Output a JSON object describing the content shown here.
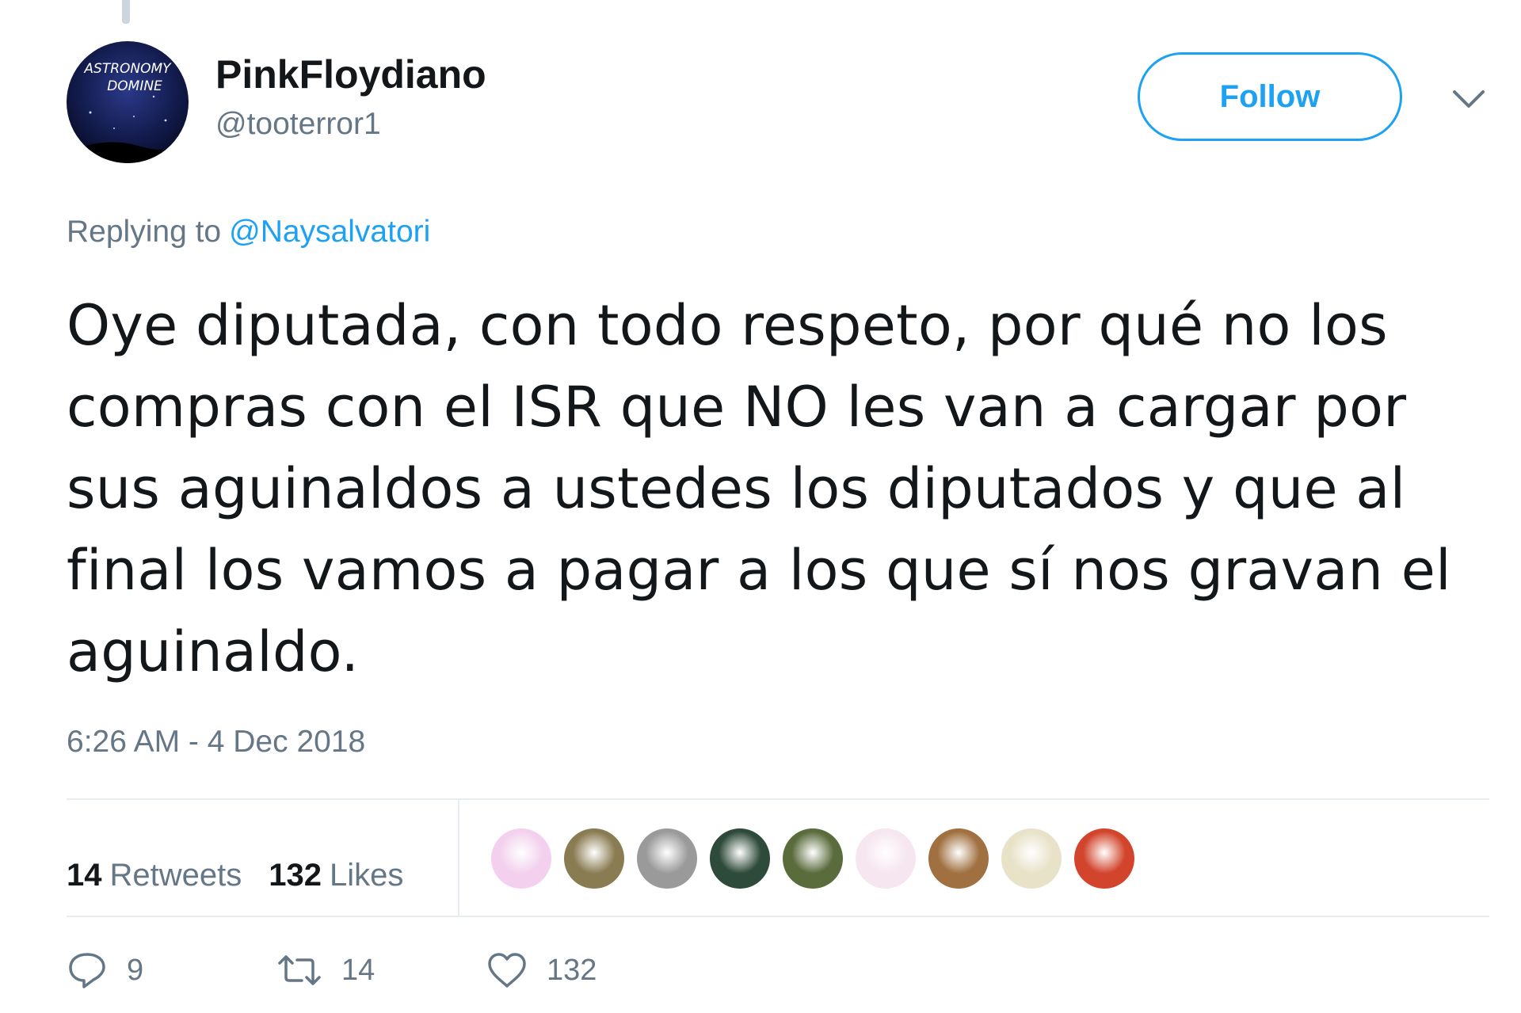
{
  "colors": {
    "accent": "#1da1f2",
    "text": "#14171a",
    "secondary": "#657786",
    "divider": "#e6ecf0"
  },
  "author": {
    "avatar_text_line1": "ASTRONOMY",
    "avatar_text_line2": "DOMINE",
    "display_name": "PinkFloydiano",
    "handle": "@tooterror1"
  },
  "header": {
    "follow_label": "Follow",
    "menu_icon": "chevron-down-icon"
  },
  "reply_context": {
    "prefix": "Replying to",
    "mention": "@Naysalvatori"
  },
  "tweet": {
    "text": "Oye diputada, con todo respeto, por qué no los compras con el ISR que NO les van a cargar por sus aguinaldos a ustedes los diputados y que al final los vamos a pagar a los que sí nos gravan el aguinaldo.",
    "timestamp": "6:26 AM - 4 Dec 2018"
  },
  "stats": {
    "retweets_count": "14",
    "retweets_label": "Retweets",
    "likes_count": "132",
    "likes_label": "Likes"
  },
  "likers": [
    {
      "name": "liker-avatar-1",
      "color": "#f3d1ee"
    },
    {
      "name": "liker-avatar-2",
      "color": "#8a7c52"
    },
    {
      "name": "liker-avatar-3",
      "color": "#9a9a9a"
    },
    {
      "name": "liker-avatar-4",
      "color": "#2e4a3a"
    },
    {
      "name": "liker-avatar-5",
      "color": "#5a6b3c"
    },
    {
      "name": "liker-avatar-6",
      "color": "#f6e6ef"
    },
    {
      "name": "liker-avatar-7",
      "color": "#a07040"
    },
    {
      "name": "liker-avatar-8",
      "color": "#e8e2c8"
    },
    {
      "name": "liker-avatar-9",
      "color": "#d2452c"
    }
  ],
  "actions": {
    "reply_icon": "reply-icon",
    "reply_count": "9",
    "retweet_icon": "retweet-icon",
    "retweet_count": "14",
    "like_icon": "heart-icon",
    "like_count": "132"
  }
}
